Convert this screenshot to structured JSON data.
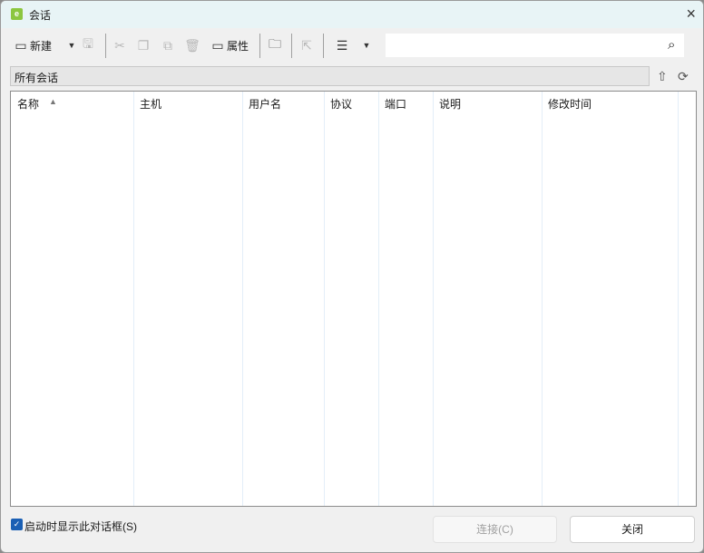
{
  "window": {
    "title": "会话",
    "app_icon": "session-app-icon",
    "close": "×"
  },
  "toolbar": {
    "new_label": "新建",
    "properties_label": "属性"
  },
  "search": {
    "placeholder": "",
    "value": ""
  },
  "path": {
    "label": "所有会话"
  },
  "table": {
    "columns": [
      "名称",
      "主机",
      "用户名",
      "协议",
      "端口",
      "说明",
      "修改时间"
    ],
    "sort_column": "名称",
    "sort": "ascending",
    "rows": []
  },
  "footer": {
    "show_on_startup_label": "启动时显示此对话框(S)",
    "show_on_startup_checked": true,
    "connect_label": "连接(C)",
    "close_label": "关闭"
  },
  "colors": {
    "titlebar": "#e8f4f6",
    "accent": "#1a5fb4",
    "app_icon": "#8cc63f"
  }
}
